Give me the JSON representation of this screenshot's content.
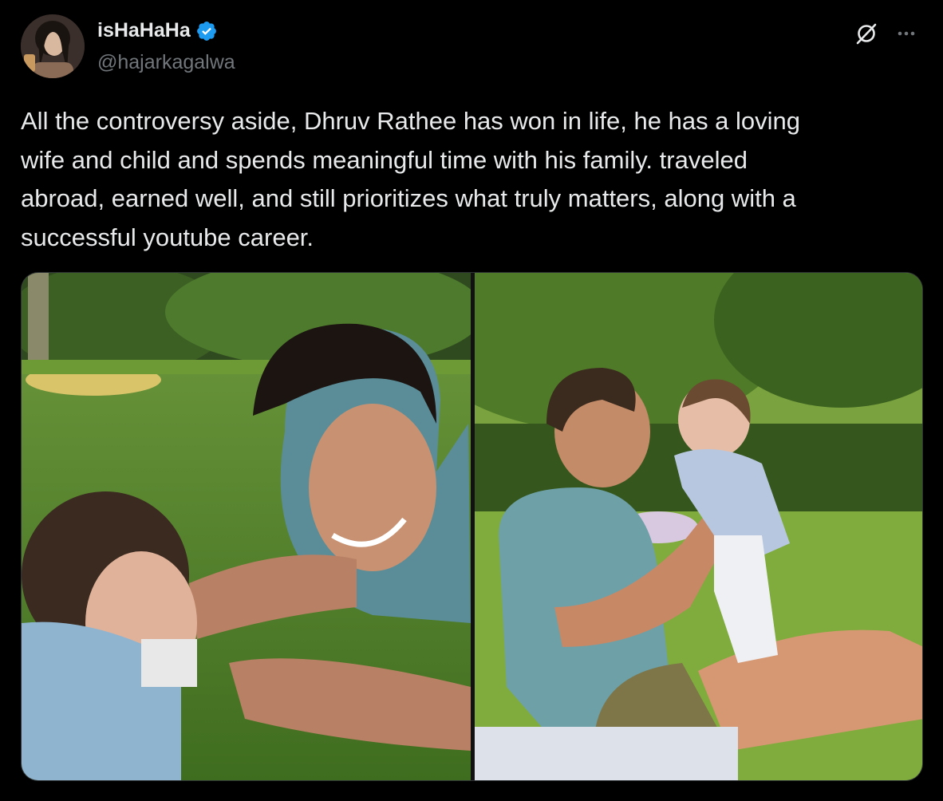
{
  "author": {
    "display_name": "isHaHaHa",
    "handle": "@hajarkagalwa",
    "verified": true,
    "verified_color": "#1d9bf0"
  },
  "actions": {
    "grok_icon": "grok-slash-circle-icon",
    "more_icon": "ellipsis-icon"
  },
  "tweet": {
    "text": "All the controversy aside, Dhruv Rathee has won in life, he has a loving\nwife and child and spends meaningful time with his family. traveled\nabroad, earned well, and still prioritizes what truly matters, along with a\nsuccessful youtube career."
  },
  "media": {
    "photos": [
      {
        "icon": "photo-man-lying-on-grass-with-baby"
      },
      {
        "icon": "photo-man-holding-baby-in-park"
      }
    ]
  }
}
